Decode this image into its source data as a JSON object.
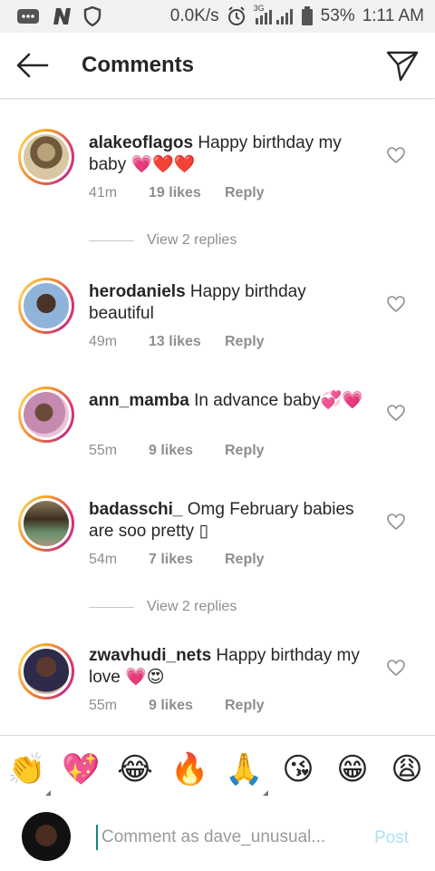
{
  "status_bar": {
    "speed": "0.0K/s",
    "network": "3G",
    "battery": "53%",
    "time": "1:11 AM"
  },
  "header": {
    "title": "Comments"
  },
  "comments": [
    {
      "username": "alakeoflagos",
      "text": " Happy birthday my baby ",
      "emojis": "💗❤️❤️",
      "time": "41m",
      "likes": "19 likes",
      "reply": "Reply",
      "view_replies": "View 2 replies"
    },
    {
      "username": "herodaniels",
      "text": " Happy birthday beautiful",
      "emojis": "",
      "time": "49m",
      "likes": "13 likes",
      "reply": "Reply"
    },
    {
      "username": "ann_mamba",
      "text": " In advance baby",
      "emojis": "💞💗",
      "time": "55m",
      "likes": "9 likes",
      "reply": "Reply"
    },
    {
      "username": "badasschi_",
      "text": " Omg February babies are soo pretty ",
      "emojis": "▯",
      "time": "54m",
      "likes": "7 likes",
      "reply": "Reply",
      "view_replies": "View 2 replies"
    },
    {
      "username": "zwavhudi_nets",
      "text": " Happy birthday my love ",
      "emojis": "💗😍",
      "time": "55m",
      "likes": "9 likes",
      "reply": "Reply"
    }
  ],
  "emoji_bar": [
    "👏",
    "💖",
    "😂",
    "🔥",
    "🙏",
    "😘",
    "😁",
    "😩"
  ],
  "composer": {
    "placeholder": "Comment as dave_unusual...",
    "post_label": "Post"
  },
  "icons": {
    "back": "arrow-left-icon",
    "send": "paper-plane-icon",
    "heart": "heart-outline-icon"
  },
  "colors": {
    "post_disabled": "#b2dffc",
    "meta_gray": "#8e8e8e",
    "text": "#262626"
  }
}
